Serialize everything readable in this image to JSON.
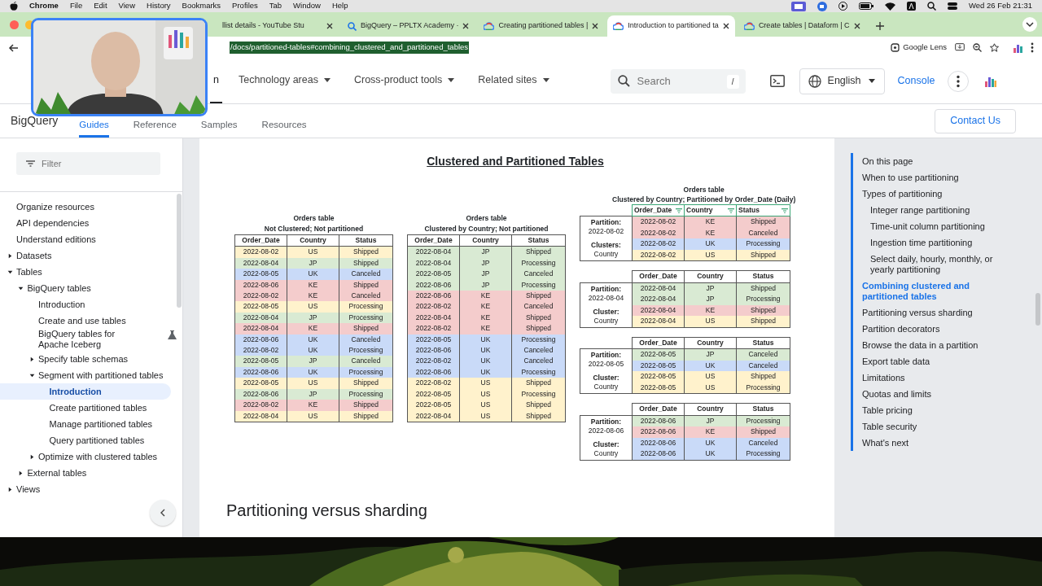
{
  "menubar": {
    "app": "Chrome",
    "items": [
      "File",
      "Edit",
      "View",
      "History",
      "Bookmarks",
      "Profiles",
      "Tab",
      "Window",
      "Help"
    ],
    "clock": "Wed 26 Feb  21:31"
  },
  "browser_tabs": [
    {
      "title": "llist details - YouTube Stu",
      "selected": false
    },
    {
      "title": "BigQuery – PPLTX Academy ·",
      "selected": false,
      "kind": "search"
    },
    {
      "title": "Creating partitioned tables |",
      "selected": false,
      "kind": "cloud"
    },
    {
      "title": "Introduction to partitioned ta",
      "selected": true,
      "kind": "cloud"
    },
    {
      "title": "Create tables | Dataform | C",
      "selected": false,
      "kind": "cloud"
    }
  ],
  "address_bar": {
    "url": "/docs/partitioned-tables#combining_clustered_and_partitioned_tables",
    "lens": "Google Lens"
  },
  "site_nav": {
    "items": [
      {
        "label": "n",
        "selected": true,
        "dropdown": false
      },
      {
        "label": "Technology areas",
        "selected": false,
        "dropdown": true
      },
      {
        "label": "Cross-product tools",
        "selected": false,
        "dropdown": true
      },
      {
        "label": "Related sites",
        "selected": false,
        "dropdown": true
      }
    ],
    "search": {
      "placeholder": "Search",
      "shortcut": "/"
    },
    "language": "English",
    "console": "Console"
  },
  "product_nav": {
    "product": "BigQuery",
    "tabs": [
      {
        "label": "Guides",
        "selected": true
      },
      {
        "label": "Reference",
        "selected": false
      },
      {
        "label": "Samples",
        "selected": false
      },
      {
        "label": "Resources",
        "selected": false
      }
    ],
    "contact": "Contact Us"
  },
  "sidebar": {
    "filter_placeholder": "Filter",
    "items": [
      {
        "label": "Organize resources",
        "selected": false
      },
      {
        "label": "API dependencies",
        "selected": false
      },
      {
        "label": "Understand editions",
        "selected": false
      },
      {
        "label": "Datasets",
        "selected": false,
        "expanded": false
      },
      {
        "label": "Tables",
        "selected": false,
        "expanded": true,
        "children": [
          {
            "label": "BigQuery tables",
            "selected": false,
            "expanded": true,
            "children": [
              {
                "label": "Introduction",
                "selected": false
              },
              {
                "label": "Create and use tables",
                "selected": false
              },
              {
                "label": "BigQuery tables for Apache Iceberg",
                "selected": false,
                "experimental": true
              },
              {
                "label": "Specify table schemas",
                "selected": false,
                "expanded": false
              },
              {
                "label": "Segment with partitioned tables",
                "selected": false,
                "expanded": true,
                "children": [
                  {
                    "label": "Introduction",
                    "selected": true
                  },
                  {
                    "label": "Create partitioned tables",
                    "selected": false
                  },
                  {
                    "label": "Manage partitioned tables",
                    "selected": false
                  },
                  {
                    "label": "Query partitioned tables",
                    "selected": false
                  }
                ]
              },
              {
                "label": "Optimize with clustered tables",
                "selected": false,
                "expanded": false
              }
            ]
          },
          {
            "label": "External tables",
            "selected": false,
            "expanded": false
          }
        ]
      },
      {
        "label": "Views",
        "selected": false,
        "expanded": false
      }
    ]
  },
  "article": {
    "diagram": {
      "title": "Clustered and Partitioned Tables",
      "tables": [
        {
          "caption": [
            "Orders table",
            "Not Clustered; Not partitioned"
          ],
          "columns": [
            "Order_Date",
            "Country",
            "Status"
          ],
          "rows": [
            {
              "cells": [
                "2022-08-02",
                "US",
                "Shipped"
              ],
              "color": "#fff2cc"
            },
            {
              "cells": [
                "2022-08-04",
                "JP",
                "Shipped"
              ],
              "color": "#d9ead3"
            },
            {
              "cells": [
                "2022-08-05",
                "UK",
                "Canceled"
              ],
              "color": "#c9daf8"
            },
            {
              "cells": [
                "2022-08-06",
                "KE",
                "Shipped"
              ],
              "color": "#f4cccc"
            },
            {
              "cells": [
                "2022-08-02",
                "KE",
                "Canceled"
              ],
              "color": "#f4cccc"
            },
            {
              "cells": [
                "2022-08-05",
                "US",
                "Processing"
              ],
              "color": "#fff2cc"
            },
            {
              "cells": [
                "2022-08-04",
                "JP",
                "Processing"
              ],
              "color": "#d9ead3"
            },
            {
              "cells": [
                "2022-08-04",
                "KE",
                "Shipped"
              ],
              "color": "#f4cccc"
            },
            {
              "cells": [
                "2022-08-06",
                "UK",
                "Canceled"
              ],
              "color": "#c9daf8"
            },
            {
              "cells": [
                "2022-08-02",
                "UK",
                "Processing"
              ],
              "color": "#c9daf8"
            },
            {
              "cells": [
                "2022-08-05",
                "JP",
                "Canceled"
              ],
              "color": "#d9ead3"
            },
            {
              "cells": [
                "2022-08-06",
                "UK",
                "Processing"
              ],
              "color": "#c9daf8"
            },
            {
              "cells": [
                "2022-08-05",
                "US",
                "Shipped"
              ],
              "color": "#fff2cc"
            },
            {
              "cells": [
                "2022-08-06",
                "JP",
                "Processing"
              ],
              "color": "#d9ead3"
            },
            {
              "cells": [
                "2022-08-02",
                "KE",
                "Shipped"
              ],
              "color": "#f4cccc"
            },
            {
              "cells": [
                "2022-08-04",
                "US",
                "Shipped"
              ],
              "color": "#fff2cc"
            }
          ]
        },
        {
          "caption": [
            "Orders table",
            "Clustered by Country; Not partitioned"
          ],
          "columns": [
            "Order_Date",
            "Country",
            "Status"
          ],
          "rows": [
            {
              "cells": [
                "2022-08-04",
                "JP",
                "Shipped"
              ],
              "color": "#d9ead3"
            },
            {
              "cells": [
                "2022-08-04",
                "JP",
                "Processing"
              ],
              "color": "#d9ead3"
            },
            {
              "cells": [
                "2022-08-05",
                "JP",
                "Canceled"
              ],
              "color": "#d9ead3"
            },
            {
              "cells": [
                "2022-08-06",
                "JP",
                "Processing"
              ],
              "color": "#d9ead3"
            },
            {
              "cells": [
                "2022-08-06",
                "KE",
                "Shipped"
              ],
              "color": "#f4cccc"
            },
            {
              "cells": [
                "2022-08-02",
                "KE",
                "Canceled"
              ],
              "color": "#f4cccc"
            },
            {
              "cells": [
                "2022-08-04",
                "KE",
                "Shipped"
              ],
              "color": "#f4cccc"
            },
            {
              "cells": [
                "2022-08-02",
                "KE",
                "Shipped"
              ],
              "color": "#f4cccc"
            },
            {
              "cells": [
                "2022-08-05",
                "UK",
                "Processing"
              ],
              "color": "#c9daf8"
            },
            {
              "cells": [
                "2022-08-06",
                "UK",
                "Canceled"
              ],
              "color": "#c9daf8"
            },
            {
              "cells": [
                "2022-08-02",
                "UK",
                "Canceled"
              ],
              "color": "#c9daf8"
            },
            {
              "cells": [
                "2022-08-06",
                "UK",
                "Processing"
              ],
              "color": "#c9daf8"
            },
            {
              "cells": [
                "2022-08-02",
                "US",
                "Shipped"
              ],
              "color": "#fff2cc"
            },
            {
              "cells": [
                "2022-08-05",
                "US",
                "Processing"
              ],
              "color": "#fff2cc"
            },
            {
              "cells": [
                "2022-08-05",
                "US",
                "Shipped"
              ],
              "color": "#fff2cc"
            },
            {
              "cells": [
                "2022-08-04",
                "US",
                "Shipped"
              ],
              "color": "#fff2cc"
            }
          ]
        }
      ],
      "partitioned": {
        "caption": [
          "Orders table",
          "Clustered by Country; Partitioned by Order_Date (Daily)"
        ],
        "partitions": [
          {
            "columns": [
              "Order_Date",
              "Country",
              "Status"
            ],
            "filter_icons": true,
            "partition_label": "Partition:",
            "partition_value": "2022-08-02",
            "cluster_label": "Clusters:",
            "cluster_value": "Country",
            "rows": [
              {
                "cells": [
                  "2022-08-02",
                  "KE",
                  "Shipped"
                ],
                "color": "#f4cccc"
              },
              {
                "cells": [
                  "2022-08-02",
                  "KE",
                  "Canceled"
                ],
                "color": "#f4cccc"
              },
              {
                "cells": [
                  "2022-08-02",
                  "UK",
                  "Processing"
                ],
                "color": "#c9daf8"
              },
              {
                "cells": [
                  "2022-08-02",
                  "US",
                  "Shipped"
                ],
                "color": "#fff2cc"
              }
            ]
          },
          {
            "columns": [
              "Order_Date",
              "Country",
              "Status"
            ],
            "filter_icons": false,
            "partition_label": "Partition:",
            "partition_value": "2022-08-04",
            "cluster_label": "Cluster:",
            "cluster_value": "Country",
            "rows": [
              {
                "cells": [
                  "2022-08-04",
                  "JP",
                  "Shipped"
                ],
                "color": "#d9ead3"
              },
              {
                "cells": [
                  "2022-08-04",
                  "JP",
                  "Processing"
                ],
                "color": "#d9ead3"
              },
              {
                "cells": [
                  "2022-08-04",
                  "KE",
                  "Shipped"
                ],
                "color": "#f4cccc"
              },
              {
                "cells": [
                  "2022-08-04",
                  "US",
                  "Shipped"
                ],
                "color": "#fff2cc"
              }
            ]
          },
          {
            "columns": [
              "Order_Date",
              "Country",
              "Status"
            ],
            "filter_icons": false,
            "partition_label": "Partition:",
            "partition_value": "2022-08-05",
            "cluster_label": "Cluster:",
            "cluster_value": "Country",
            "rows": [
              {
                "cells": [
                  "2022-08-05",
                  "JP",
                  "Canceled"
                ],
                "color": "#d9ead3"
              },
              {
                "cells": [
                  "2022-08-05",
                  "UK",
                  "Canceled"
                ],
                "color": "#c9daf8"
              },
              {
                "cells": [
                  "2022-08-05",
                  "US",
                  "Shipped"
                ],
                "color": "#fff2cc"
              },
              {
                "cells": [
                  "2022-08-05",
                  "US",
                  "Processing"
                ],
                "color": "#fff2cc"
              }
            ]
          },
          {
            "columns": [
              "Order_Date",
              "Country",
              "Status"
            ],
            "filter_icons": false,
            "partition_label": "Partition:",
            "partition_value": "2022-08-06",
            "cluster_label": "Cluster:",
            "cluster_value": "Country",
            "rows": [
              {
                "cells": [
                  "2022-08-06",
                  "JP",
                  "Processing"
                ],
                "color": "#d9ead3"
              },
              {
                "cells": [
                  "2022-08-06",
                  "KE",
                  "Shipped"
                ],
                "color": "#f4cccc"
              },
              {
                "cells": [
                  "2022-08-06",
                  "UK",
                  "Canceled"
                ],
                "color": "#c9daf8"
              },
              {
                "cells": [
                  "2022-08-06",
                  "UK",
                  "Processing"
                ],
                "color": "#c9daf8"
              }
            ]
          }
        ]
      }
    },
    "heading": "Partitioning versus sharding"
  },
  "toc": {
    "title": "On this page",
    "items": [
      {
        "label": "When to use partitioning",
        "selected": false
      },
      {
        "label": "Types of partitioning",
        "selected": false,
        "children": [
          {
            "label": "Integer range partitioning",
            "selected": false
          },
          {
            "label": "Time-unit column partitioning",
            "selected": false
          },
          {
            "label": "Ingestion time partitioning",
            "selected": false
          },
          {
            "label": "Select daily, hourly, monthly, or yearly partitioning",
            "selected": false
          }
        ]
      },
      {
        "label": "Combining clustered and partitioned tables",
        "selected": true
      },
      {
        "label": "Partitioning versus sharding",
        "selected": false
      },
      {
        "label": "Partition decorators",
        "selected": false
      },
      {
        "label": "Browse the data in a partition",
        "selected": false
      },
      {
        "label": "Export table data",
        "selected": false
      },
      {
        "label": "Limitations",
        "selected": false
      },
      {
        "label": "Quotas and limits",
        "selected": false
      },
      {
        "label": "Table pricing",
        "selected": false
      },
      {
        "label": "Table security",
        "selected": false
      },
      {
        "label": "What's next",
        "selected": false
      }
    ]
  }
}
